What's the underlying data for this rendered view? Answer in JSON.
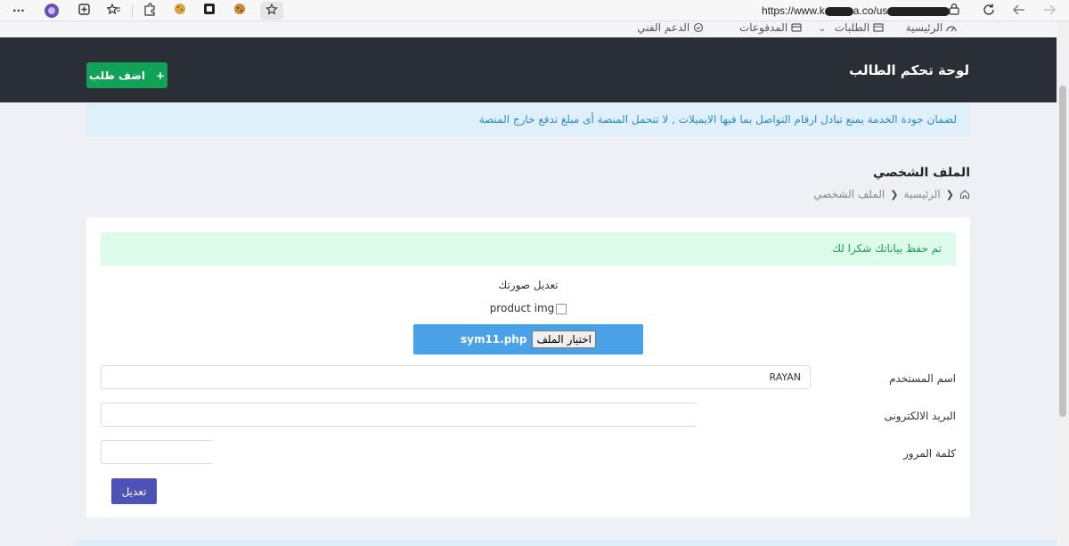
{
  "browser": {
    "url_prefix": "https://www.k",
    "url_mid": "a.co/us",
    "more_label": "···"
  },
  "topnav": {
    "home": "الرئيسية",
    "requests": "الطلبات",
    "payments": "المدفوعات",
    "support": "الدعم الفني"
  },
  "header": {
    "title": "لوحة تحكم الطالب",
    "add_button": "اضف طلب",
    "add_icon": "+"
  },
  "notice": "لضمان جودة الخدمة يمنع تبادل ارقام التواصل بما فيها الايميلات , لا تتحمل المنصة أى مبلغ تدفع خارج المنصة",
  "page": {
    "title": "الملف الشخصي",
    "breadcrumb": [
      "الرئيسية",
      "الملف الشخصي"
    ]
  },
  "card": {
    "success": "تم حفظ بياناتك شكرا لك",
    "photo_label": "تعديل صورتك",
    "img_alt": "product img",
    "file_button": "اختيار الملف",
    "file_name": "sym11.php",
    "username_label": "اسم المستخدم",
    "username_value": "RAYAN",
    "email_label": "البريد الالكترونى",
    "email_value": "",
    "password_label": "كلمة المرور",
    "password_value": "",
    "submit": "تعديل"
  },
  "colors": {
    "header_bg": "#2a2f36",
    "add_button": "#12a257",
    "submit_button": "#4d52b7",
    "file_box": "#49a1e8",
    "success_bg": "#dcfbea",
    "notice_bg": "#dff0fb"
  }
}
